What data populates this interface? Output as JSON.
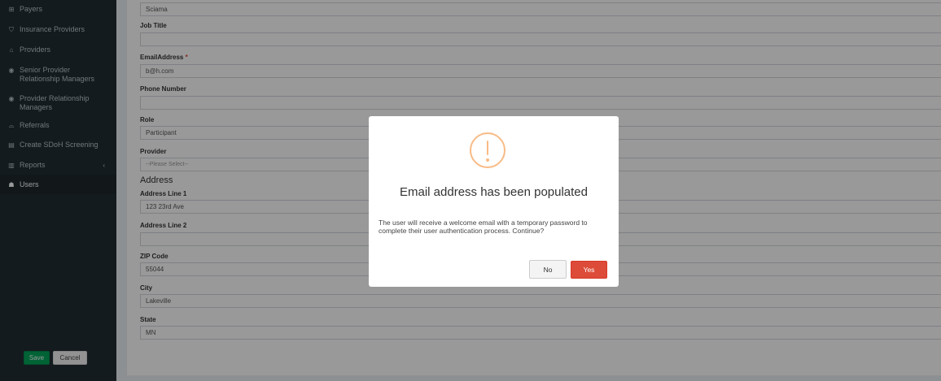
{
  "sidebar": {
    "items": [
      {
        "label": "Payers",
        "icon": "payers-icon",
        "glyph": "⊞"
      },
      {
        "label": "Insurance Providers",
        "icon": "shield-icon",
        "glyph": "⛉"
      },
      {
        "label": "Providers",
        "icon": "building-icon",
        "glyph": "⌂"
      },
      {
        "label": "Senior Provider Relationship Managers",
        "icon": "user-circle-icon",
        "glyph": "◉"
      },
      {
        "label": "Provider Relationship Managers",
        "icon": "user-circle-icon",
        "glyph": "◉"
      },
      {
        "label": "Referrals",
        "icon": "inbox-icon",
        "glyph": "⌓"
      },
      {
        "label": "Create SDoH Screening",
        "icon": "clipboard-icon",
        "glyph": "▤"
      },
      {
        "label": "Reports",
        "icon": "chart-icon",
        "glyph": "▥"
      },
      {
        "label": "Users",
        "icon": "users-icon",
        "glyph": "☗"
      }
    ],
    "reports_chevron": "‹"
  },
  "form": {
    "last_name_value": "Sciama",
    "job_title_label": "Job Title",
    "job_title_value": "",
    "email_label": "EmailAddress",
    "required_mark": "*",
    "email_value": "b@h.com",
    "phone_label": "Phone Number",
    "phone_value": "",
    "role_label": "Role",
    "role_value": "Participant",
    "provider_label": "Provider",
    "provider_placeholder": "--Please Select--",
    "address_heading": "Address",
    "address1_label": "Address Line 1",
    "address1_value": "123 23rd Ave",
    "address2_label": "Address Line 2",
    "address2_value": "",
    "zip_label": "ZIP Code",
    "zip_value": "55044",
    "city_label": "City",
    "city_value": "Lakeville",
    "state_label": "State",
    "state_value": "MN",
    "save_label": "Save",
    "cancel_label": "Cancel"
  },
  "modal": {
    "title": "Email address has been populated",
    "text": "The user will receive a welcome email with a temporary password to complete their user authentication process. Continue?",
    "no_label": "No",
    "yes_label": "Yes",
    "icon": "warning-icon",
    "icon_color": "#f8bb86",
    "yes_color": "#dd4b39"
  }
}
